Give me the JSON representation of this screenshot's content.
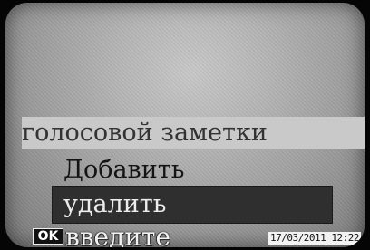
{
  "menu": {
    "title": "голосовой заметки",
    "items": [
      {
        "label": "Добавить",
        "selected": false
      },
      {
        "label": "удалить",
        "selected": true
      }
    ]
  },
  "footer": {
    "ok_label": "OK",
    "hint": "введите",
    "datetime": "17/03/2011 12:22"
  }
}
